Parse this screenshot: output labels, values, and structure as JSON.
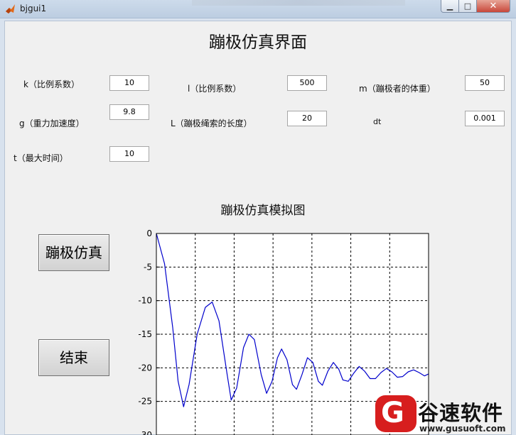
{
  "window": {
    "title": "bjgui1",
    "minimize_glyph": "▁",
    "maximize_glyph": "□",
    "close_glyph": "✕"
  },
  "form": {
    "title": "蹦极仿真界面",
    "fields": [
      {
        "label": "k（比例系数）",
        "value": "10"
      },
      {
        "label": "l（比例系数）",
        "value": "500"
      },
      {
        "label": "m（蹦极者的体重）",
        "value": "50"
      },
      {
        "label": "g（重力加速度）",
        "value": "9.8"
      },
      {
        "label": "L（蹦极绳索的长度）",
        "value": "20"
      },
      {
        "label": "dt",
        "value": "0.001"
      },
      {
        "label": "t（最大时间）",
        "value": "10"
      }
    ]
  },
  "buttons": {
    "simulate": "蹦极仿真",
    "end": "结束"
  },
  "plot": {
    "title": "蹦极仿真模拟图"
  },
  "chart_data": {
    "type": "line",
    "title": "蹦极仿真模拟图",
    "xlabel": "",
    "ylabel": "",
    "ylim": [
      -30,
      0
    ],
    "xlim": [
      0,
      10
    ],
    "yticks": [
      "0",
      "-5",
      "-10",
      "-15",
      "-20",
      "-25",
      "-30"
    ],
    "grid": true,
    "series_color": "#0000cc",
    "series": [
      {
        "points": [
          [
            0.0,
            0.0
          ],
          [
            0.3,
            -4.5
          ],
          [
            0.6,
            -14.0
          ],
          [
            0.8,
            -22.0
          ],
          [
            1.0,
            -25.8
          ],
          [
            1.2,
            -22.5
          ],
          [
            1.5,
            -15.0
          ],
          [
            1.8,
            -11.0
          ],
          [
            2.05,
            -10.2
          ],
          [
            2.3,
            -13.0
          ],
          [
            2.6,
            -21.0
          ],
          [
            2.75,
            -24.8
          ],
          [
            2.95,
            -23.0
          ],
          [
            3.2,
            -17.0
          ],
          [
            3.4,
            -15.0
          ],
          [
            3.6,
            -15.8
          ],
          [
            3.85,
            -21.0
          ],
          [
            4.05,
            -23.8
          ],
          [
            4.25,
            -22.0
          ],
          [
            4.45,
            -18.5
          ],
          [
            4.6,
            -17.2
          ],
          [
            4.8,
            -18.8
          ],
          [
            5.0,
            -22.5
          ],
          [
            5.15,
            -23.2
          ],
          [
            5.35,
            -21.0
          ],
          [
            5.55,
            -18.5
          ],
          [
            5.75,
            -19.2
          ],
          [
            5.95,
            -22.0
          ],
          [
            6.1,
            -22.6
          ],
          [
            6.3,
            -20.5
          ],
          [
            6.5,
            -19.2
          ],
          [
            6.7,
            -20.2
          ],
          [
            6.85,
            -21.8
          ],
          [
            7.05,
            -22.0
          ],
          [
            7.25,
            -20.8
          ],
          [
            7.45,
            -19.8
          ],
          [
            7.65,
            -20.5
          ],
          [
            7.85,
            -21.6
          ],
          [
            8.05,
            -21.6
          ],
          [
            8.25,
            -20.7
          ],
          [
            8.45,
            -20.1
          ],
          [
            8.65,
            -20.6
          ],
          [
            8.85,
            -21.4
          ],
          [
            9.05,
            -21.3
          ],
          [
            9.25,
            -20.6
          ],
          [
            9.45,
            -20.3
          ],
          [
            9.65,
            -20.7
          ],
          [
            9.85,
            -21.2
          ],
          [
            10.0,
            -20.9
          ]
        ]
      }
    ]
  },
  "watermark": {
    "logo_letter": "G",
    "text": "谷速软件",
    "url": "www.gusuoft.com"
  }
}
